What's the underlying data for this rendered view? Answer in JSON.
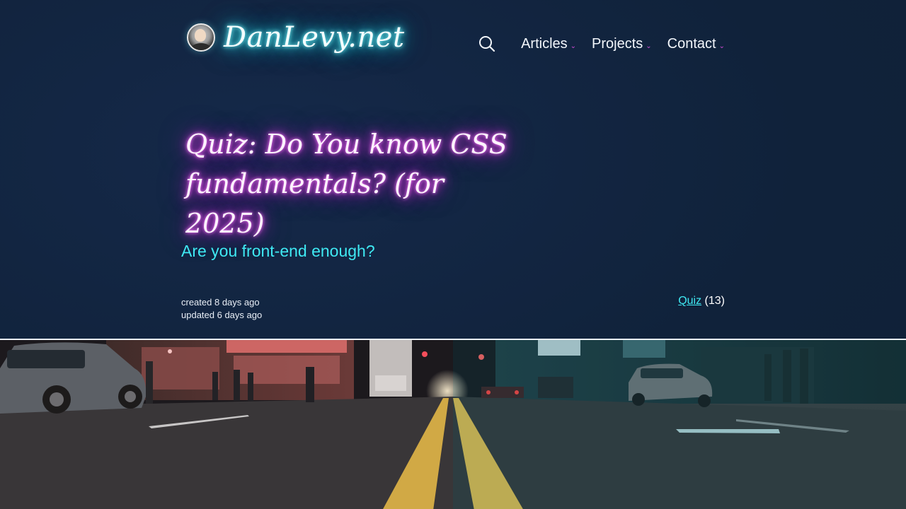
{
  "header": {
    "site_name": "DanLevy.net",
    "nav": [
      {
        "label": "Articles"
      },
      {
        "label": "Projects"
      },
      {
        "label": "Contact"
      }
    ]
  },
  "article": {
    "title": "Quiz: Do You know CSS fundamentals? (for 2025)",
    "subtitle": "Are you front-end enough?",
    "created": "created 8 days ago",
    "updated": "updated 6 days ago",
    "tag": {
      "label": "Quiz",
      "count": "(13)"
    }
  },
  "colors": {
    "background": "#10223a",
    "accent_cyan": "#3fe9f3",
    "accent_magenta": "#d24bd8"
  },
  "icons": {
    "search": "search-icon",
    "dropdown": "chevron-down-icon"
  }
}
